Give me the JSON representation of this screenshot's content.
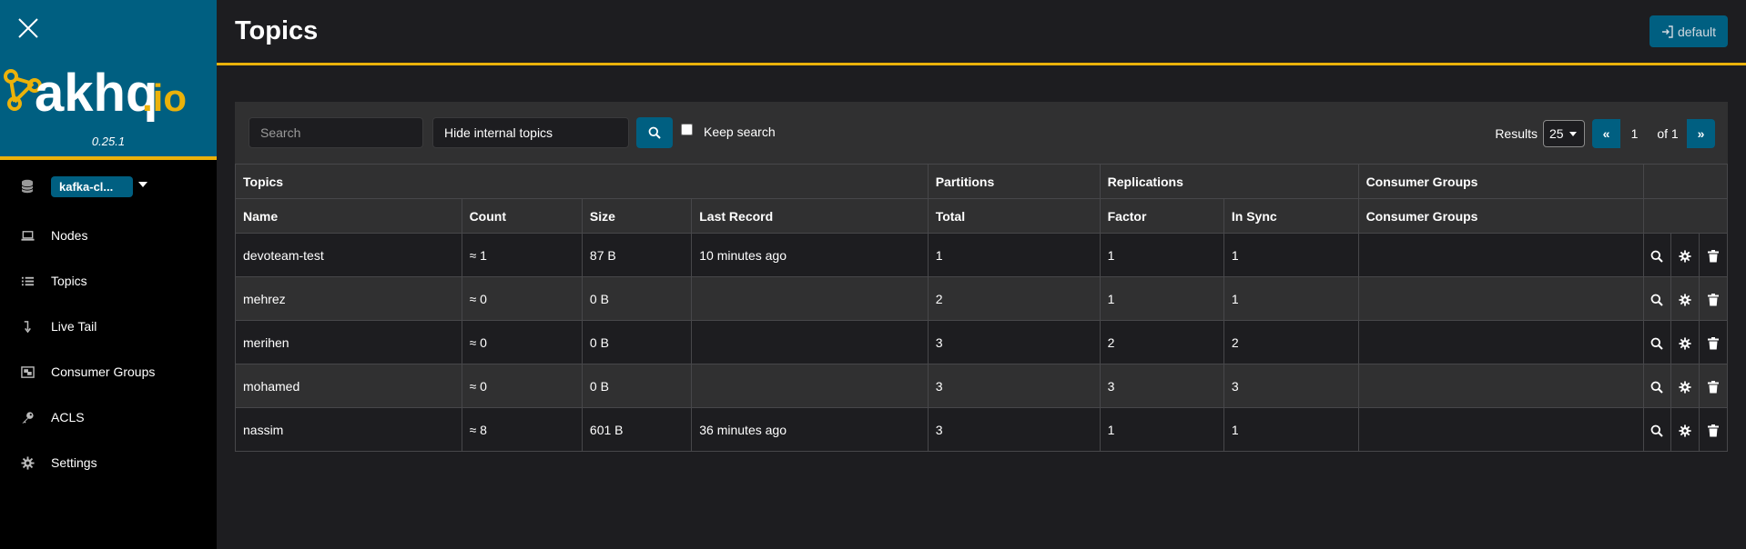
{
  "app": {
    "logo_text": "akhq.io",
    "version": "0.25.1"
  },
  "cluster": {
    "name": "kafka-cl..."
  },
  "sidebar": {
    "items": [
      {
        "label": "Nodes",
        "icon": "laptop-icon"
      },
      {
        "label": "Topics",
        "icon": "list-icon"
      },
      {
        "label": "Live Tail",
        "icon": "level-down-icon"
      },
      {
        "label": "Consumer Groups",
        "icon": "object-group-icon"
      },
      {
        "label": "ACLS",
        "icon": "key-icon"
      },
      {
        "label": "Settings",
        "icon": "gear-icon"
      }
    ]
  },
  "header": {
    "title": "Topics",
    "login_label": "default"
  },
  "toolbar": {
    "search_placeholder": "Search",
    "filter_value": "Hide internal topics",
    "keep_search_label": "Keep search",
    "results_label": "Results",
    "results_value": "25",
    "page_first": "«",
    "page_current": "1",
    "page_of": "of 1",
    "page_last": "»"
  },
  "table": {
    "group_headers": [
      "Topics",
      "Partitions",
      "Replications",
      "Consumer Groups"
    ],
    "columns": [
      "Name",
      "Count",
      "Size",
      "Last Record",
      "Total",
      "Factor",
      "In Sync",
      "Consumer Groups"
    ],
    "rows": [
      [
        "devoteam-test",
        "≈ 1",
        "87 B",
        "10 minutes ago",
        "1",
        "1",
        "1",
        ""
      ],
      [
        "mehrez",
        "≈ 0",
        "0 B",
        "",
        "2",
        "1",
        "1",
        ""
      ],
      [
        "merihen",
        "≈ 0",
        "0 B",
        "",
        "3",
        "2",
        "2",
        ""
      ],
      [
        "mohamed",
        "≈ 0",
        "0 B",
        "",
        "3",
        "3",
        "3",
        ""
      ],
      [
        "nassim",
        "≈ 8",
        "601 B",
        "36 minutes ago",
        "3",
        "1",
        "1",
        ""
      ]
    ]
  },
  "colors": {
    "brand": "#005f81",
    "accent": "#ebb20a",
    "background": "#1d1d20",
    "panel": "#303031"
  }
}
